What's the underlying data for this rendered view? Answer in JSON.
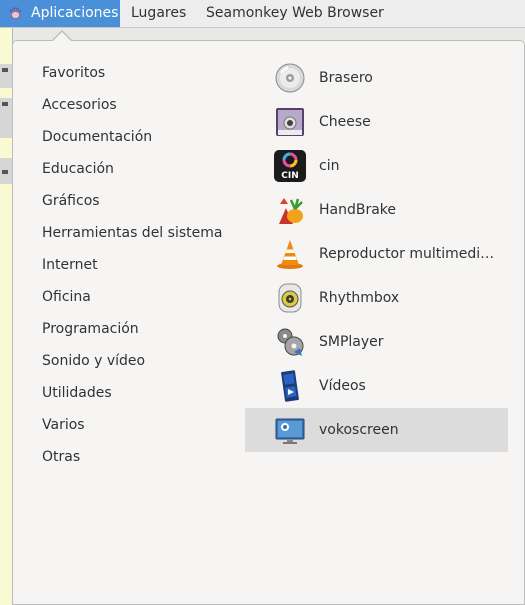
{
  "topbar": {
    "applications_label": "Aplicaciones",
    "places_label": "Lugares",
    "active_window_label": "Seamonkey Web Browser"
  },
  "menu": {
    "categories": [
      "Favoritos",
      "Accesorios",
      "Documentación",
      "Educación",
      "Gráficos",
      "Herramientas del sistema",
      "Internet",
      "Oficina",
      "Programación",
      "Sonido y vídeo",
      "Utilidades",
      "Varios",
      "Otras"
    ],
    "apps": [
      {
        "label": "Brasero",
        "icon": "brasero-icon"
      },
      {
        "label": "Cheese",
        "icon": "cheese-icon"
      },
      {
        "label": "cin",
        "icon": "cin-icon"
      },
      {
        "label": "HandBrake",
        "icon": "handbrake-icon"
      },
      {
        "label": "Reproductor multimedi…",
        "icon": "vlc-icon"
      },
      {
        "label": "Rhythmbox",
        "icon": "rhythmbox-icon"
      },
      {
        "label": "SMPlayer",
        "icon": "smplayer-icon"
      },
      {
        "label": "Vídeos",
        "icon": "videos-icon"
      },
      {
        "label": "vokoscreen",
        "icon": "vokoscreen-icon",
        "selected": true
      }
    ]
  },
  "colors": {
    "accent": "#4a90d9",
    "selected_row": "#dcdcdc"
  }
}
